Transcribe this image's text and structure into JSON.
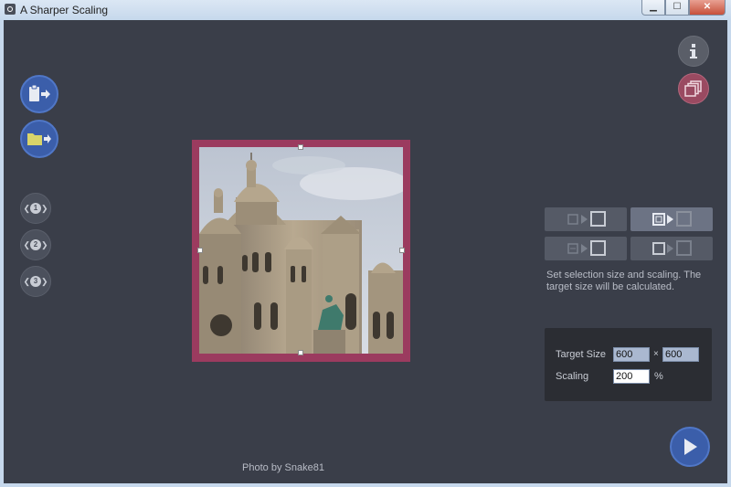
{
  "window": {
    "title": "A Sharper Scaling",
    "minimize_glyph": "▁",
    "maximize_glyph": "☐",
    "close_glyph": "✕"
  },
  "left_toolbar": {
    "paste_icon": "clipboard-paste-icon",
    "open_icon": "folder-open-icon",
    "presets": [
      "1",
      "2",
      "3"
    ]
  },
  "right_toolbar": {
    "info_icon": "info-icon",
    "batch_icon": "stack-icon"
  },
  "photo": {
    "credit": "Photo by Snake81"
  },
  "modes": {
    "items": [
      {
        "name": "source-to-target",
        "selected": false
      },
      {
        "name": "selection-to-target",
        "selected": true
      },
      {
        "name": "stretch-to-target",
        "selected": false
      },
      {
        "name": "selection-stretch",
        "selected": false
      }
    ],
    "description": "Set selection size and scaling. The target size will be calculated."
  },
  "settings": {
    "target_size_label": "Target Size",
    "width_value": "600",
    "height_value": "600",
    "times_label": "×",
    "scaling_label": "Scaling",
    "scaling_value": "200",
    "percent_label": "%"
  },
  "colors": {
    "background": "#3a3e49",
    "accent_blue": "#3b5eaa",
    "frame_magenta": "#9b3b5f",
    "panel": "#2b2d33"
  }
}
